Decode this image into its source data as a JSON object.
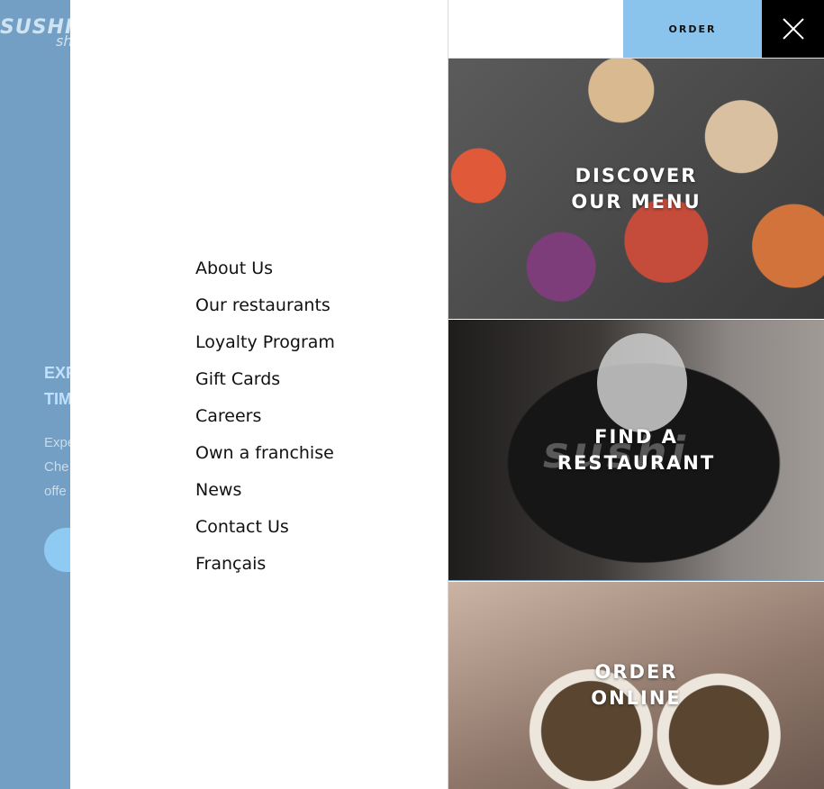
{
  "background": {
    "logo_main": "SUSHI",
    "logo_sub": "shop",
    "heading_lines": [
      "EXP",
      "TIM"
    ],
    "text_lines": [
      "Expe",
      "Che",
      "offe"
    ]
  },
  "menu": {
    "items": [
      {
        "label": "About Us"
      },
      {
        "label": "Our restaurants"
      },
      {
        "label": "Loyalty Program"
      },
      {
        "label": "Gift Cards"
      },
      {
        "label": "Careers"
      },
      {
        "label": "Own a franchise"
      },
      {
        "label": "News"
      },
      {
        "label": "Contact Us"
      },
      {
        "label": "Français"
      }
    ]
  },
  "header": {
    "order_label": "ORDER",
    "close_icon": "close-icon"
  },
  "tiles": [
    {
      "label": "DISCOVER\nOUR MENU"
    },
    {
      "label": "FIND A\nRESTAURANT",
      "emblem_text": "sushi"
    },
    {
      "label": "ORDER\nONLINE"
    }
  ],
  "colors": {
    "accent": "#8ac4ec",
    "background_page": "#729fc3",
    "close_bg": "#000000"
  }
}
